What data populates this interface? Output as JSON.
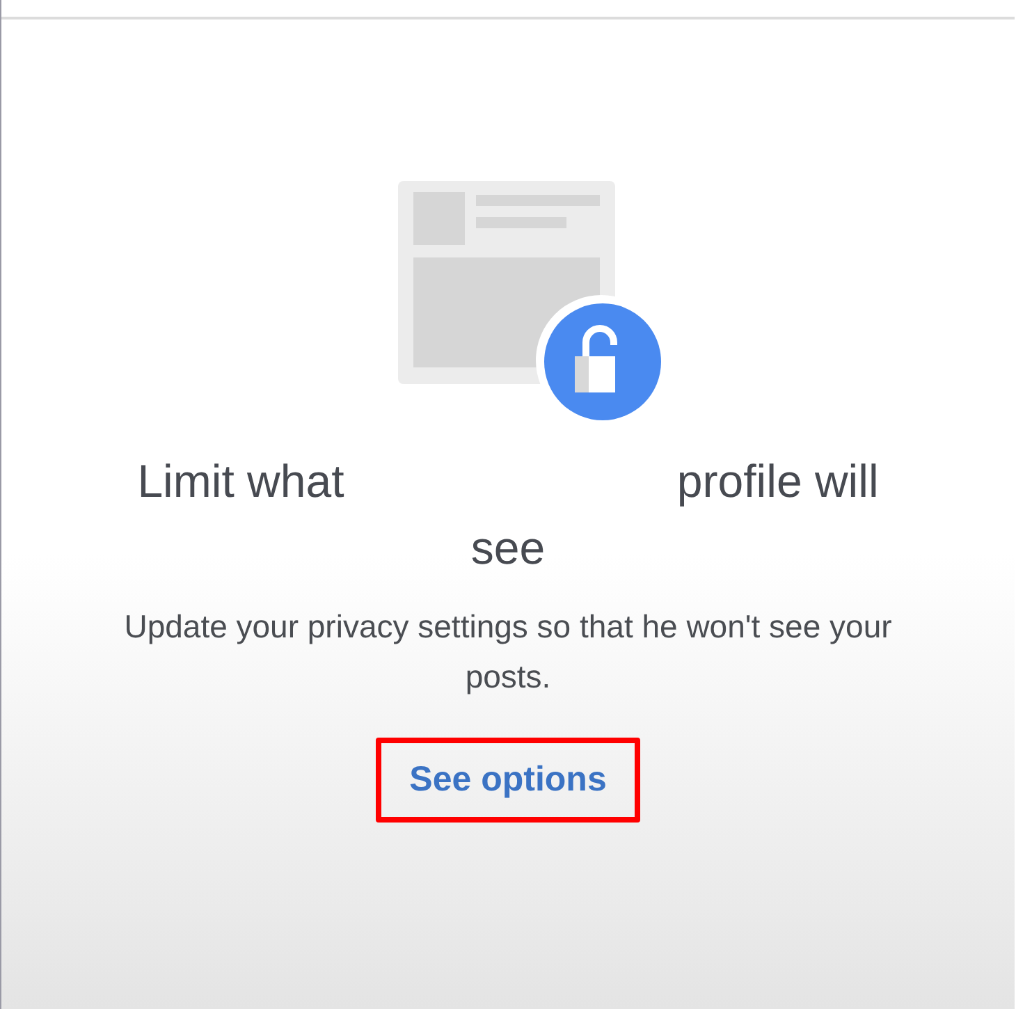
{
  "card": {
    "title_start": "Limit what",
    "title_end": "profile will see",
    "message": "Update your privacy settings so that he won't see your posts.",
    "button": {
      "label": "See options",
      "highlighted": true
    }
  }
}
